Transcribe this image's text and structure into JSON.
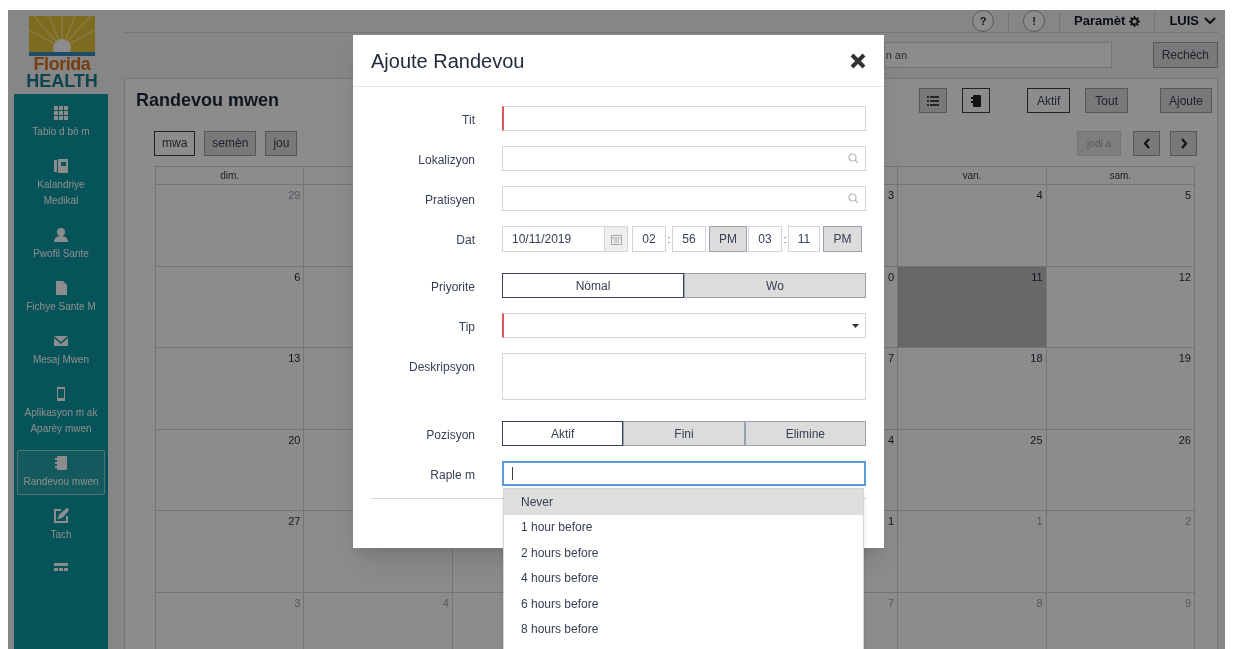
{
  "logo": {
    "line1": "Florida",
    "line2": "HEALTH"
  },
  "sidebar": {
    "items": [
      {
        "label": "Tablo d bò m",
        "selected": false
      },
      {
        "label": "Kalandriye Medikal",
        "selected": false
      },
      {
        "label": "Pwofil Sante",
        "selected": false
      },
      {
        "label": "Fichye Sante M",
        "selected": false
      },
      {
        "label": "Mesaj Mwen",
        "selected": false
      },
      {
        "label": "Aplikasyon m ak Aparèy mwen",
        "selected": false
      },
      {
        "label": "Randevou mwen",
        "selected": true
      },
      {
        "label": "Tach",
        "selected": false
      },
      {
        "selected": false
      }
    ]
  },
  "header": {
    "help": "?",
    "alert": "!",
    "settings": "Paramèt",
    "user": "LUIS"
  },
  "search": {
    "placeholder": "n an",
    "button": "Rechèch"
  },
  "panel": {
    "title": "Randevou mwen",
    "views": [
      {
        "kind": "list",
        "selected": false
      },
      {
        "kind": "notebook",
        "selected": true
      }
    ],
    "filters": [
      {
        "label": "Aktif",
        "selected": true
      },
      {
        "label": "Tout",
        "selected": false
      }
    ],
    "add_button": "Ajoute",
    "ranges": [
      {
        "label": "mwa",
        "selected": true
      },
      {
        "label": "semèn",
        "selected": false
      },
      {
        "label": "jou",
        "selected": false
      }
    ],
    "today_button": {
      "label": "jodi a",
      "disabled": true
    }
  },
  "calendar": {
    "columns": {
      "column_1": "dim.",
      "column_6": "van.",
      "column_7": "sam."
    },
    "weeks": [
      {
        "column_1": {
          "day": "29",
          "other_month": true,
          "today": false
        },
        "column_5": {
          "day": "3",
          "other_month": false,
          "today": false
        },
        "column_6": {
          "day": "4",
          "other_month": false,
          "today": false
        },
        "column_7": {
          "day": "5",
          "other_month": false,
          "today": false
        }
      },
      {
        "column_1": {
          "day": "6",
          "other_month": false,
          "today": false
        },
        "column_5": {
          "day": "0",
          "other_month": false,
          "today": false
        },
        "column_6": {
          "day": "11",
          "other_month": false,
          "today": true
        },
        "column_7": {
          "day": "12",
          "other_month": false,
          "today": false
        }
      },
      {
        "column_1": {
          "day": "13",
          "other_month": false,
          "today": false
        },
        "column_5": {
          "day": "7",
          "other_month": false,
          "today": false
        },
        "column_6": {
          "day": "18",
          "other_month": false,
          "today": false
        },
        "column_7": {
          "day": "19",
          "other_month": false,
          "today": false
        }
      },
      {
        "column_1": {
          "day": "20",
          "other_month": false,
          "today": false
        },
        "column_5": {
          "day": "4",
          "other_month": false,
          "today": false
        },
        "column_6": {
          "day": "25",
          "other_month": false,
          "today": false
        },
        "column_7": {
          "day": "26",
          "other_month": false,
          "today": false
        }
      },
      {
        "column_1": {
          "day": "27",
          "other_month": false,
          "today": false
        },
        "column_5": {
          "day": "1",
          "other_month": false,
          "today": false
        },
        "column_6": {
          "day": "1",
          "other_month": true,
          "today": false
        },
        "column_7": {
          "day": "2",
          "other_month": true,
          "today": false
        }
      },
      {
        "column_1": {
          "day": "3",
          "other_month": true,
          "today": false
        },
        "column_2": {
          "day": "4",
          "other_month": true,
          "today": false
        },
        "column_5": {
          "day": "7",
          "other_month": true,
          "today": false
        },
        "column_6": {
          "day": "8",
          "other_month": true,
          "today": false
        },
        "column_7": {
          "day": "9",
          "other_month": true,
          "today": false
        }
      }
    ]
  },
  "dialog": {
    "title": "Ajoute Randevou",
    "fields": [
      {
        "kind": "text",
        "label": "Tit",
        "required": true,
        "focused": false
      },
      {
        "kind": "search",
        "label": "Lokalizyon",
        "required": false,
        "focused": false
      },
      {
        "kind": "search",
        "label": "Pratisyen",
        "required": false,
        "focused": false
      },
      {
        "kind": "datetime",
        "label": "Dat",
        "date": "10/11/2019",
        "start_hour": "02",
        "start_separator": ":",
        "start_minute": "56",
        "start_period": "PM",
        "end_hour": "03",
        "end_separator": ":",
        "end_minute": "11",
        "end_period": "PM"
      },
      {
        "kind": "segmented",
        "label": "Priyorite",
        "options": [
          {
            "label": "Nòmal",
            "selected": true
          },
          {
            "label": "Wo",
            "selected": false
          }
        ]
      },
      {
        "kind": "select",
        "label": "Tip",
        "required": true,
        "focused": false
      },
      {
        "kind": "textarea",
        "label": "Deskripsyon",
        "required": false,
        "focused": false
      },
      {
        "kind": "segmented",
        "label": "Pozisyon",
        "options": [
          {
            "label": "Aktif",
            "selected": true
          },
          {
            "label": "Fini",
            "selected": false
          },
          {
            "label": "Elimine",
            "selected": false
          }
        ]
      },
      {
        "kind": "text",
        "label": "Raple m",
        "required": false,
        "focused": true
      }
    ]
  },
  "reminder_dropdown": {
    "options": [
      {
        "label": "Never",
        "selected": true
      },
      {
        "label": "1 hour before",
        "selected": false
      },
      {
        "label": "2 hours before",
        "selected": false
      },
      {
        "label": "4 hours before",
        "selected": false
      },
      {
        "label": "6 hours before",
        "selected": false
      },
      {
        "label": "8 hours before",
        "selected": false
      }
    ]
  }
}
